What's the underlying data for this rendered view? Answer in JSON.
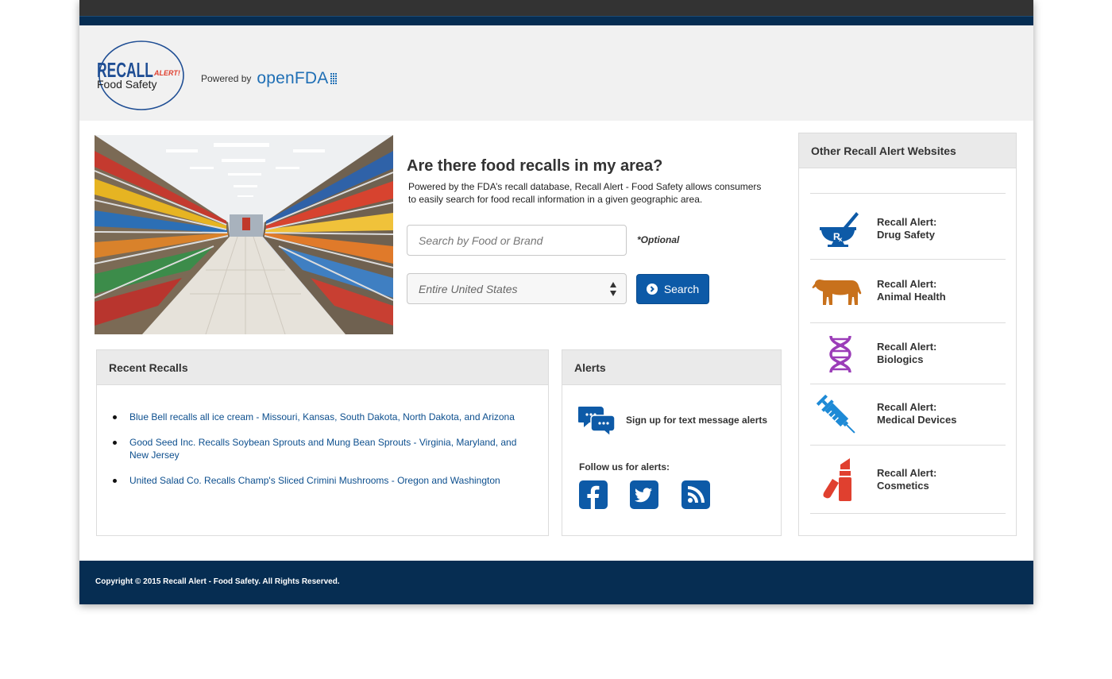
{
  "brand": {
    "logo_word": "RECALL",
    "logo_alert": "ALERT!",
    "logo_sub": "Food Safety",
    "powered_label": "Powered by",
    "openfda_open": "open",
    "openfda_fda": "FDA"
  },
  "intro": {
    "title": "Are there food recalls in my area?",
    "description": "Powered by the FDA’s recall database, Recall Alert - Food Safety allows consumers to easily search for food recall information in a given geographic area."
  },
  "search": {
    "placeholder": "Search by Food or Brand",
    "optional_label": "*Optional",
    "location_value": "Entire United States",
    "button_label": "Search"
  },
  "recent": {
    "title": "Recent Recalls",
    "items": [
      "Blue Bell recalls all ice cream - Missouri, Kansas, South Dakota, North Dakota, and Arizona",
      "Good Seed Inc. Recalls Soybean Sprouts and Mung Bean Sprouts - Virginia, Maryland, and New Jersey",
      "United Salad Co. Recalls Champ's Sliced Crimini Mushrooms - Oregon and Washington"
    ]
  },
  "alerts": {
    "title": "Alerts",
    "signup_text": "Sign up for text message alerts",
    "follow_label": "Follow us for alerts:",
    "social": [
      "facebook-icon",
      "twitter-icon",
      "rss-icon"
    ]
  },
  "other": {
    "title": "Other Recall Alert Websites",
    "items": [
      {
        "line1": "Recall Alert:",
        "line2": "Drug Safety",
        "icon": "mortar-pestle-rx-icon",
        "color": "#0d5aa7"
      },
      {
        "line1": "Recall Alert:",
        "line2": "Animal Health",
        "icon": "cow-icon",
        "color": "#c8711c"
      },
      {
        "line1": "Recall Alert:",
        "line2": "Biologics",
        "icon": "dna-icon",
        "color": "#9b3db8"
      },
      {
        "line1": "Recall Alert:",
        "line2": "Medical Devices",
        "icon": "syringe-icon",
        "color": "#1e8ad6"
      },
      {
        "line1": "Recall Alert:",
        "line2": "Cosmetics",
        "icon": "lipstick-icon",
        "color": "#e0402f"
      }
    ]
  },
  "footer": {
    "copyright": "Copyright © 2015 Recall Alert - Food Safety. All Rights Reserved."
  },
  "colors": {
    "primary": "#0d5aa7",
    "navy": "#062d52",
    "link": "#0d4f8e"
  }
}
